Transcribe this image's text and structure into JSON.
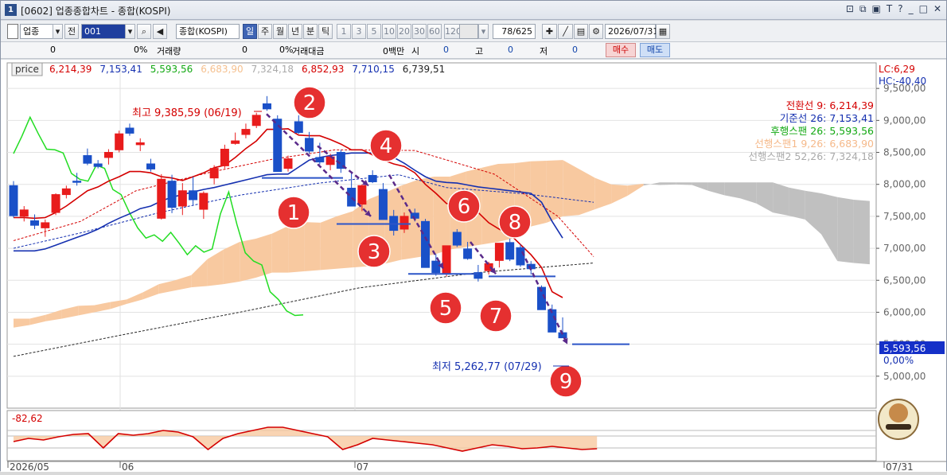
{
  "window": {
    "title": "[0602] 업종종합차트 - 종합(KOSPI)",
    "app_number": "1"
  },
  "toolbar": {
    "market_select": "업종",
    "all_button": "전",
    "code_value": "001",
    "index_name": "종합(KOSPI)",
    "period_tabs": [
      "일",
      "주",
      "월",
      "년",
      "분",
      "틱"
    ],
    "active_period": "일",
    "minute_options": [
      "1",
      "3",
      "5",
      "10",
      "20",
      "30",
      "60",
      "120"
    ],
    "count_value": "78",
    "count_total": "/625",
    "date_value": "2026/07/31"
  },
  "infobar": {
    "price": "0",
    "change_pct": "0%",
    "volume_label": "거래량",
    "volume_value": "0",
    "volume_pct": "0%",
    "amount_label": "거래대금",
    "amount_value": "0백만",
    "open_label": "시",
    "open_value": "0",
    "high_label": "고",
    "high_value": "0",
    "low_label": "저",
    "low_value": "0",
    "buy_label": "매수",
    "sell_label": "매도"
  },
  "price_header": {
    "label": "price",
    "values": [
      "6,214,39",
      "7,153,41",
      "5,593,56",
      "6,683,90",
      "7,324,18",
      "6,852,93",
      "7,710,15",
      "6,739,51"
    ],
    "colors": [
      "#d40000",
      "#1530b0",
      "#12a812",
      "#f5c08f",
      "#aaaaaa",
      "#d40000",
      "#1530b0",
      "#222222"
    ]
  },
  "right_panel": {
    "lc": "LC:6,29",
    "hc": "HC:-40,40",
    "current_price": "5,593,56",
    "current_pct": "0,00%",
    "indicator_value": "-82,62"
  },
  "legend": [
    {
      "label": "전환선 9: 6,214,39",
      "color": "#d40000"
    },
    {
      "label": "기준선 26: 7,153,41",
      "color": "#1530b0"
    },
    {
      "label": "후행스팬 26: 5,593,56",
      "color": "#12a812"
    },
    {
      "label": "선행스팬1 9,26: 6,683,90",
      "color": "#f5b98a"
    },
    {
      "label": "선행스팬2 52,26: 7,324,18",
      "color": "#aaaaaa"
    }
  ],
  "annotations": {
    "high_label": "최고 9,385,59 (06/19)",
    "low_label": "최저 5,262,77 (07/29)",
    "circle_numbers": [
      "1",
      "2",
      "3",
      "4",
      "5",
      "6",
      "7",
      "8",
      "9"
    ]
  },
  "chart_data": {
    "type": "candlestick",
    "ylim": [
      4500,
      9900
    ],
    "yticks": [
      "9,500,00",
      "9,000,00",
      "8,500,00",
      "8,000,00",
      "7,500,00",
      "7,000,00",
      "6,500,00",
      "6,000,00",
      "5,500,00",
      "5,000,00"
    ],
    "ytick_values": [
      9500,
      9000,
      8500,
      8000,
      7500,
      7000,
      6500,
      6000,
      5500,
      5000
    ],
    "x_labels": [
      "2026/05",
      "06",
      "07",
      "07/31"
    ],
    "candles": [
      [
        7980,
        8050,
        7480,
        7510
      ],
      [
        7500,
        7660,
        7420,
        7600
      ],
      [
        7430,
        7530,
        7300,
        7360
      ],
      [
        7320,
        7450,
        7180,
        7400
      ],
      [
        7560,
        7860,
        7520,
        7840
      ],
      [
        7840,
        7980,
        7780,
        7930
      ],
      [
        8050,
        8180,
        7980,
        8040
      ],
      [
        8450,
        8560,
        8300,
        8330
      ],
      [
        8320,
        8380,
        8250,
        8280
      ],
      [
        8420,
        8550,
        8310,
        8500
      ],
      [
        8540,
        8840,
        8500,
        8790
      ],
      [
        8880,
        8950,
        8760,
        8800
      ],
      [
        8620,
        8720,
        8520,
        8650
      ],
      [
        8320,
        8400,
        8200,
        8240
      ],
      [
        7470,
        8160,
        7450,
        8080
      ],
      [
        8050,
        8150,
        7550,
        7640
      ],
      [
        7660,
        8020,
        7520,
        7900
      ],
      [
        7900,
        8120,
        7680,
        7760
      ],
      [
        7610,
        7890,
        7460,
        7860
      ],
      [
        8100,
        8300,
        8000,
        8250
      ],
      [
        8290,
        8620,
        8250,
        8550
      ],
      [
        8640,
        8810,
        8620,
        8680
      ],
      [
        8780,
        8950,
        8720,
        8860
      ],
      [
        8920,
        9120,
        8880,
        9080
      ],
      [
        9260,
        9380,
        9150,
        9180
      ],
      [
        9020,
        9080,
        8300,
        8200
      ],
      [
        8250,
        8450,
        8200,
        8400
      ],
      [
        8980,
        9080,
        8790,
        8810
      ],
      [
        8720,
        8820,
        8480,
        8520
      ],
      [
        8420,
        8650,
        8310,
        8350
      ],
      [
        8310,
        8480,
        8220,
        8430
      ],
      [
        8500,
        8540,
        8180,
        8250
      ],
      [
        7940,
        8180,
        7710,
        7660
      ],
      [
        7690,
        8000,
        7580,
        7980
      ],
      [
        8140,
        8220,
        8020,
        8040
      ],
      [
        7920,
        8020,
        7640,
        7450
      ],
      [
        7500,
        7600,
        7200,
        7280
      ],
      [
        7300,
        7560,
        7240,
        7500
      ],
      [
        7550,
        7620,
        7420,
        7470
      ],
      [
        7420,
        7460,
        6700,
        6700
      ],
      [
        6800,
        6910,
        6570,
        6620
      ],
      [
        6600,
        6800,
        6560,
        7040
      ],
      [
        7250,
        7300,
        7020,
        7050
      ],
      [
        6990,
        7100,
        6820,
        6840
      ],
      [
        6620,
        6740,
        6480,
        6530
      ],
      [
        6650,
        6790,
        6590,
        6760
      ],
      [
        6810,
        6850,
        6700,
        7080
      ],
      [
        7090,
        7150,
        6800,
        6830
      ],
      [
        7010,
        7060,
        6710,
        6740
      ],
      [
        6750,
        6800,
        6590,
        6680
      ],
      [
        6390,
        6420,
        6080,
        6040
      ],
      [
        6040,
        6120,
        5690,
        5690
      ],
      [
        5680,
        5920,
        5600,
        5600
      ]
    ],
    "tenkan": [
      7480,
      7480,
      7470,
      7480,
      7560,
      7660,
      7780,
      7900,
      7960,
      8050,
      8120,
      8200,
      8200,
      8180,
      8120,
      8100,
      8060,
      8120,
      8180,
      8260,
      8300,
      8420,
      8560,
      8680,
      8860,
      8860,
      8870,
      8770,
      8760,
      8760,
      8700,
      8630,
      8540,
      8540,
      8460,
      8380,
      8320,
      8280,
      8180,
      8000,
      7860,
      7700,
      7680,
      7620,
      7560,
      7400,
      7300,
      7220,
      7060,
      6900,
      6700,
      6320,
      6230
    ],
    "kijun": [
      6960,
      6960,
      6960,
      6990,
      7050,
      7110,
      7170,
      7230,
      7300,
      7390,
      7470,
      7540,
      7620,
      7660,
      7740,
      7800,
      7840,
      7880,
      7920,
      7950,
      7990,
      8030,
      8070,
      8110,
      8150,
      8160,
      8160,
      8270,
      8380,
      8420,
      8450,
      8470,
      8490,
      8490,
      8490,
      8470,
      8420,
      8330,
      8220,
      8120,
      8050,
      8030,
      8020,
      7990,
      7960,
      7940,
      7920,
      7900,
      7880,
      7860,
      7720,
      7420,
      7160
    ],
    "chikou": [
      8480,
      8750,
      9050,
      8790,
      8550,
      8540,
      8490,
      8170,
      8080,
      8050,
      8300,
      8250,
      7920,
      7840,
      7560,
      7320,
      7160,
      7210,
      7110,
      7250,
      7080,
      6900,
      7040,
      6940,
      6990,
      7540,
      7880,
      7370,
      6930,
      6800,
      6740,
      6320,
      6200,
      6020,
      5950,
      5960
    ],
    "senkou1": [
      5900,
      5900,
      5960,
      6040,
      6100,
      6110,
      6160,
      6200,
      6310,
      6440,
      6500,
      6580,
      6830,
      6980,
      7100,
      7150,
      7230,
      7350,
      7410,
      7400,
      7500,
      7580,
      7770,
      7870,
      7980,
      8070,
      8120,
      8120,
      8200,
      8260,
      8320,
      8330,
      8360,
      8370,
      8380,
      8240,
      8100,
      8000,
      7980,
      8010,
      7990,
      8000,
      7990,
      7900,
      7830,
      7780,
      7700,
      7560,
      7510,
      7450,
      7220,
      6800,
      6770,
      6750
    ],
    "senkou2": [
      5760,
      5800,
      5860,
      5900,
      5950,
      6000,
      6050,
      6130,
      6200,
      6290,
      6340,
      6390,
      6410,
      6440,
      6480,
      6540,
      6620,
      6620,
      6640,
      6660,
      6680,
      6700,
      6720,
      6760,
      6820,
      6860,
      6900,
      6980,
      7020,
      7060,
      7100,
      7160,
      7340,
      7400,
      7500,
      7520,
      7610,
      7700,
      7820,
      7980,
      8030,
      8030,
      8030,
      8030,
      8030,
      8030,
      8030,
      8030,
      7950,
      7900,
      7860,
      7800,
      7760,
      7740,
      7340
    ]
  },
  "colors": {
    "up": "#e81c1c",
    "down": "#1a50c8",
    "cloud_up": "#f8c9a0",
    "cloud_down": "#c0c0c0",
    "arrow": "#5a2a8a",
    "badge": "#e53030"
  }
}
